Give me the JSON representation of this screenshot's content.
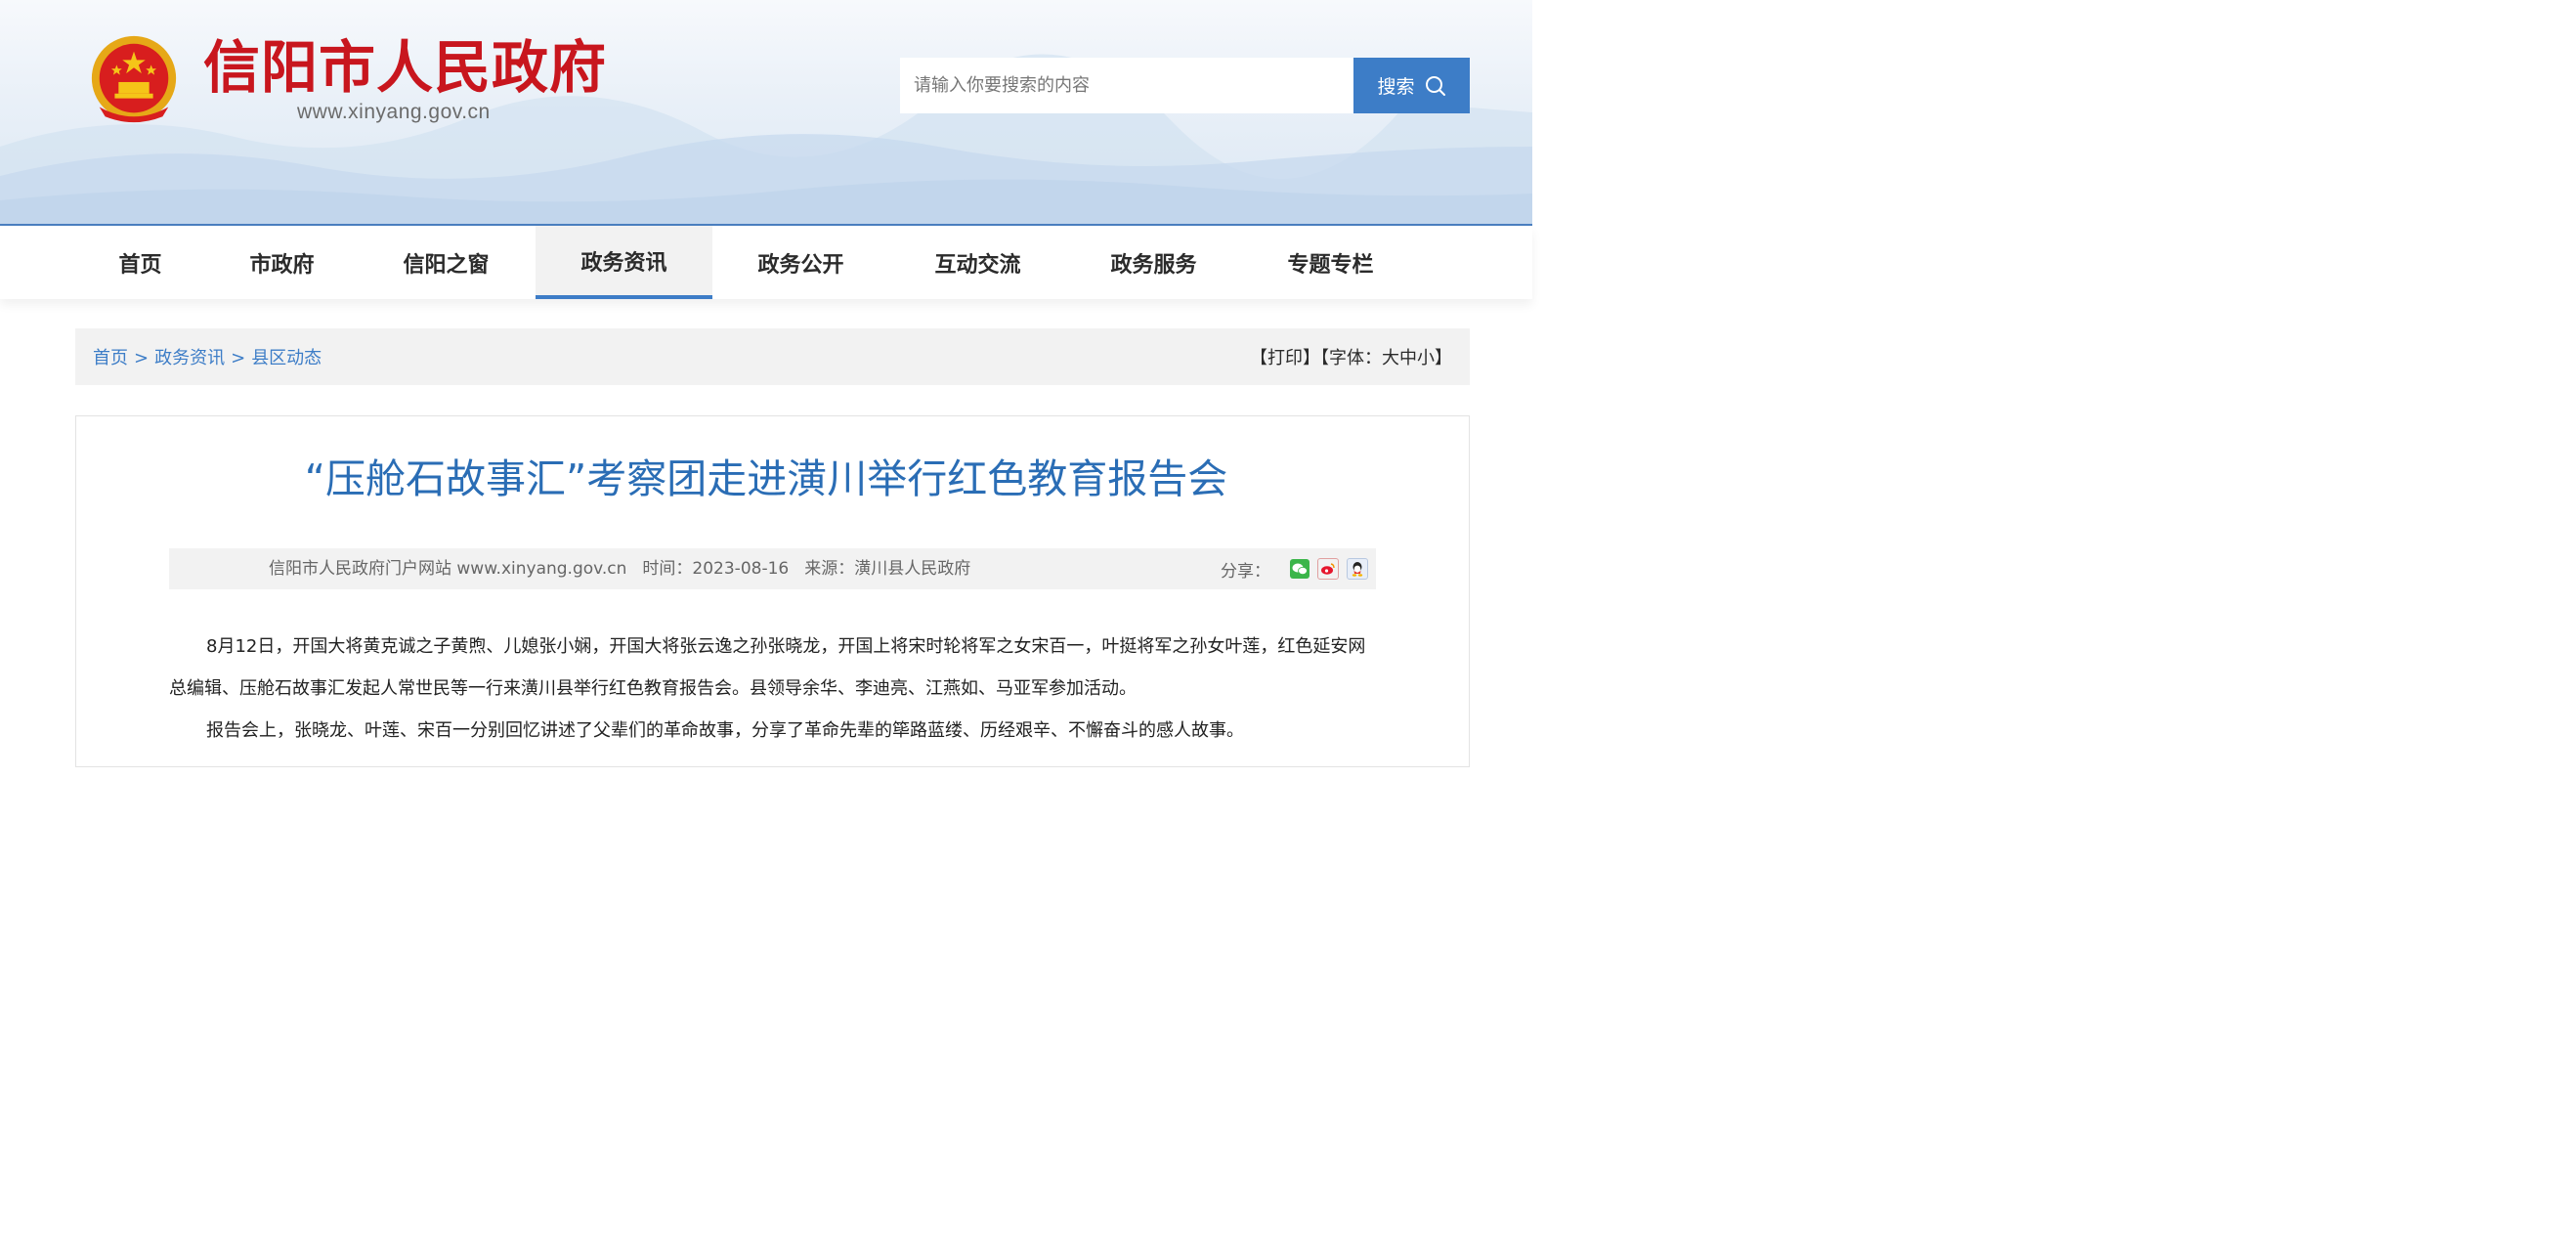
{
  "header": {
    "site_title": "信阳市人民政府",
    "site_url": "www.xinyang.gov.cn",
    "search_placeholder": "请输入你要搜索的内容",
    "search_button": "搜索",
    "accent_color": "#3d7dc7",
    "title_color": "#c8161e"
  },
  "nav": {
    "items": [
      {
        "label": "首页"
      },
      {
        "label": "市政府"
      },
      {
        "label": "信阳之窗"
      },
      {
        "label": "政务资讯",
        "active": true
      },
      {
        "label": "政务公开"
      },
      {
        "label": "互动交流"
      },
      {
        "label": "政务服务"
      },
      {
        "label": "专题专栏"
      }
    ]
  },
  "breadcrumb": {
    "items": [
      "首页",
      "政务资讯",
      "县区动态"
    ],
    "separator": ">"
  },
  "tools": {
    "print": "【打印】",
    "font_size": "【字体：大中小】"
  },
  "article": {
    "title": "“压舱石故事汇”考察团走进潢川举行红色教育报告会",
    "meta": {
      "site": "信阳市人民政府门户网站 www.xinyang.gov.cn",
      "time": "时间：2023-08-16",
      "source": "来源：潢川县人民政府"
    },
    "share_label": "分享：",
    "share_icons": [
      "wechat-icon",
      "weibo-icon",
      "qq-icon"
    ],
    "paragraphs": [
      "8月12日，开国大将黄克诚之子黄煦、儿媳张小娴，开国大将张云逸之孙张晓龙，开国上将宋时轮将军之女宋百一，叶挺将军之孙女叶莲，红色延安网总编辑、压舱石故事汇发起人常世民等一行来潢川县举行红色教育报告会。县领导余华、李迪亮、江燕如、马亚军参加活动。",
      "报告会上，张晓龙、叶莲、宋百一分别回忆讲述了父辈们的革命故事，分享了革命先辈的筚路蓝缕、历经艰辛、不懈奋斗的感人故事。"
    ]
  }
}
